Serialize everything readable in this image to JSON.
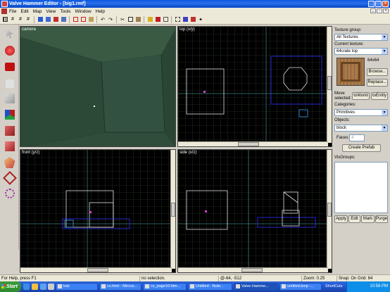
{
  "window": {
    "title": "Valve Hammer Editor - [big1.rmf]"
  },
  "menu": {
    "items": [
      "File",
      "Edit",
      "Map",
      "View",
      "Tools",
      "Window",
      "Help"
    ]
  },
  "viewports": {
    "camera": "camera",
    "top": "top (x/y)",
    "front": "front (y/z)",
    "side": "side (x/z)"
  },
  "panel": {
    "texture_group_label": "Texture group:",
    "texture_group_value": "All Textures",
    "current_texture_label": "Current texture:",
    "current_texture_value": "64crate top",
    "texture_size": "64x64",
    "browse_label": "Browse...",
    "replace_label": "Replace...",
    "move_selected_label": "Move selected:",
    "to_world_label": "toWorld",
    "to_entity_label": "toEntity",
    "categories_label": "Categories:",
    "categories_value": "Primitives",
    "objects_label": "Objects:",
    "objects_value": "block",
    "faces_label": "Faces:",
    "faces_value": "4",
    "create_prefab_label": "Create Prefab",
    "visgroups_label": "VisGroups:",
    "apply_label": "Apply",
    "edit_label": "Edit",
    "mark_label": "Mark",
    "purge_label": "Purge"
  },
  "status": {
    "help": "For Help, press F1",
    "selection": "no selection.",
    "coords": "@-64, -512",
    "zoom": "Zoom: 0.25",
    "snap": "Snap: On Grid: 64"
  },
  "taskbar": {
    "start": "Start",
    "tasks": [
      "tuts",
      "cs.html - Micros...",
      "cs_page10.htm...",
      "Untitled - Note...",
      "Valve Hamme...",
      "untitled.bmp -..."
    ],
    "shortcuts": "ShortCuts",
    "clock": "10:58 PM"
  },
  "colors": {
    "title_blue": "#0a58e0",
    "grid": "#2a3a2a",
    "brush_white": "#e0e0e0",
    "selection_blue": "#3030ff"
  }
}
